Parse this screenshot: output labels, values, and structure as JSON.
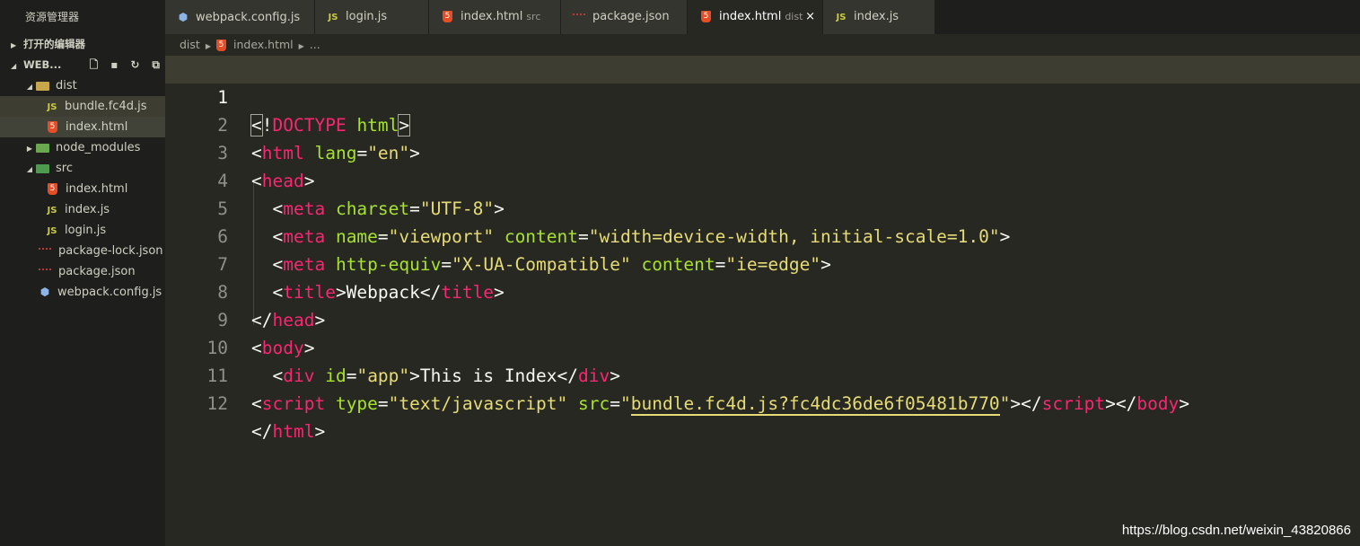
{
  "explorer": {
    "title": "资源管理器",
    "open_editors": "打开的编辑器",
    "project": "WEB...",
    "tree": [
      {
        "label": "dist",
        "kind": "folder",
        "icon": "folder-icon"
      },
      {
        "label": "bundle.fc4d.js",
        "kind": "js",
        "icon": "js-file-icon"
      },
      {
        "label": "index.html",
        "kind": "html",
        "icon": "html-file-icon"
      },
      {
        "label": "node_modules",
        "kind": "folder",
        "icon": "node-folder-icon"
      },
      {
        "label": "src",
        "kind": "folder",
        "icon": "src-folder-icon"
      },
      {
        "label": "index.html",
        "kind": "html",
        "icon": "html-file-icon"
      },
      {
        "label": "index.js",
        "kind": "js",
        "icon": "js-file-icon"
      },
      {
        "label": "login.js",
        "kind": "js",
        "icon": "js-file-icon"
      },
      {
        "label": "package-lock.json",
        "kind": "json",
        "icon": "json-file-icon"
      },
      {
        "label": "package.json",
        "kind": "json",
        "icon": "json-file-icon"
      },
      {
        "label": "webpack.config.js",
        "kind": "webpack",
        "icon": "webpack-icon"
      }
    ]
  },
  "tabs": [
    {
      "label": "webpack.config.js",
      "desc": ""
    },
    {
      "label": "login.js",
      "desc": ""
    },
    {
      "label": "index.html",
      "desc": "src"
    },
    {
      "label": "package.json",
      "desc": ""
    },
    {
      "label": "index.html",
      "desc": "dist",
      "close": "×"
    },
    {
      "label": "index.js",
      "desc": ""
    }
  ],
  "breadcrumb": {
    "folder": "dist",
    "file": "index.html",
    "more": "..."
  },
  "editor": {
    "line_numbers": [
      "1",
      "2",
      "3",
      "4",
      "5",
      "6",
      "7",
      "8",
      "9",
      "10",
      "11",
      "12"
    ]
  },
  "watermark": "https://blog.csdn.net/weixin_43820866",
  "colors": {
    "background": "#272822",
    "tag": "#f92672",
    "attr": "#a6e22e",
    "string": "#e6db74"
  }
}
